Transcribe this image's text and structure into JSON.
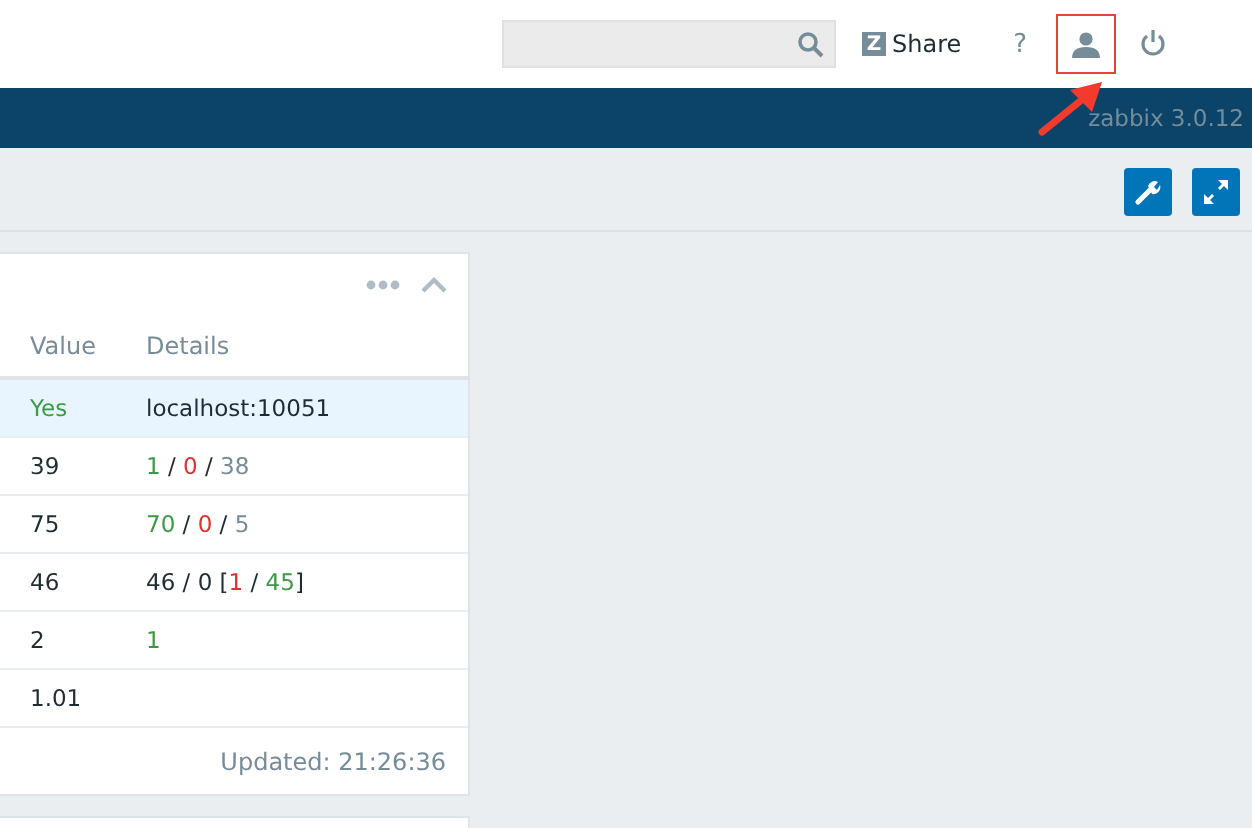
{
  "header": {
    "share": {
      "logo": "Z",
      "label": "Share"
    },
    "help": "?",
    "user": {
      "highlighted": true
    }
  },
  "banner": {
    "version": "zabbix 3.0.12"
  },
  "widget": {
    "columns": [
      "Value",
      "Details"
    ],
    "rows": [
      {
        "selected": true,
        "value": {
          "text": "Yes",
          "color": "#3d9a44"
        },
        "details": [
          {
            "text": "localhost:10051"
          }
        ]
      },
      {
        "selected": false,
        "value": {
          "text": "39"
        },
        "details": [
          {
            "text": "1",
            "color": "#3d9a44"
          },
          {
            "text": " / "
          },
          {
            "text": "0",
            "color": "#e0312f"
          },
          {
            "text": " / "
          },
          {
            "text": "38",
            "color": "#768d99"
          }
        ]
      },
      {
        "selected": false,
        "value": {
          "text": "75"
        },
        "details": [
          {
            "text": "70",
            "color": "#3d9a44"
          },
          {
            "text": " / "
          },
          {
            "text": "0",
            "color": "#e0312f"
          },
          {
            "text": " / "
          },
          {
            "text": "5",
            "color": "#768d99"
          }
        ]
      },
      {
        "selected": false,
        "value": {
          "text": "46"
        },
        "details": [
          {
            "text": "46 / 0 ["
          },
          {
            "text": "1",
            "color": "#e0312f"
          },
          {
            "text": " / "
          },
          {
            "text": "45",
            "color": "#3d9a44"
          },
          {
            "text": "]"
          }
        ]
      },
      {
        "selected": false,
        "value": {
          "text": "2"
        },
        "details": [
          {
            "text": "1",
            "color": "#3d9a44"
          }
        ]
      },
      {
        "selected": false,
        "value": {
          "text": "1.01"
        },
        "details": []
      }
    ],
    "footer": "Updated: 21:26:36"
  }
}
